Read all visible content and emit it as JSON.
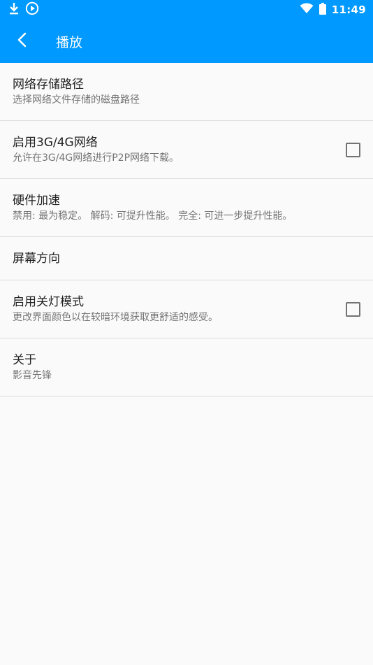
{
  "status_bar": {
    "time": "11:49",
    "icons": [
      "download-icon",
      "play-circle-icon",
      "wifi-icon",
      "battery-icon"
    ]
  },
  "app_bar": {
    "title": "播放",
    "back_icon": "chevron-left-icon"
  },
  "colors": {
    "primary": "#0099ff",
    "background": "#fafafa",
    "divider": "#dcdcdc",
    "title_text": "#212121",
    "summary_text": "#757575"
  },
  "settings": [
    {
      "title": "网络存储路径",
      "summary": "选择网络文件存储的磁盘路径",
      "has_checkbox": false,
      "checked": null
    },
    {
      "title": "启用3G/4G网络",
      "summary": "允许在3G/4G网络进行P2P网络下载。",
      "has_checkbox": true,
      "checked": false
    },
    {
      "title": "硬件加速",
      "summary": "禁用: 最为稳定。 解码: 可提升性能。 完全: 可进一步提升性能。",
      "has_checkbox": false,
      "checked": null
    },
    {
      "title": "屏幕方向",
      "summary": "",
      "has_checkbox": false,
      "checked": null
    },
    {
      "title": "启用关灯模式",
      "summary": "更改界面颜色以在较暗环境获取更舒适的感受。",
      "has_checkbox": true,
      "checked": false
    },
    {
      "title": "关于",
      "summary": "影音先锋",
      "has_checkbox": false,
      "checked": null
    }
  ]
}
